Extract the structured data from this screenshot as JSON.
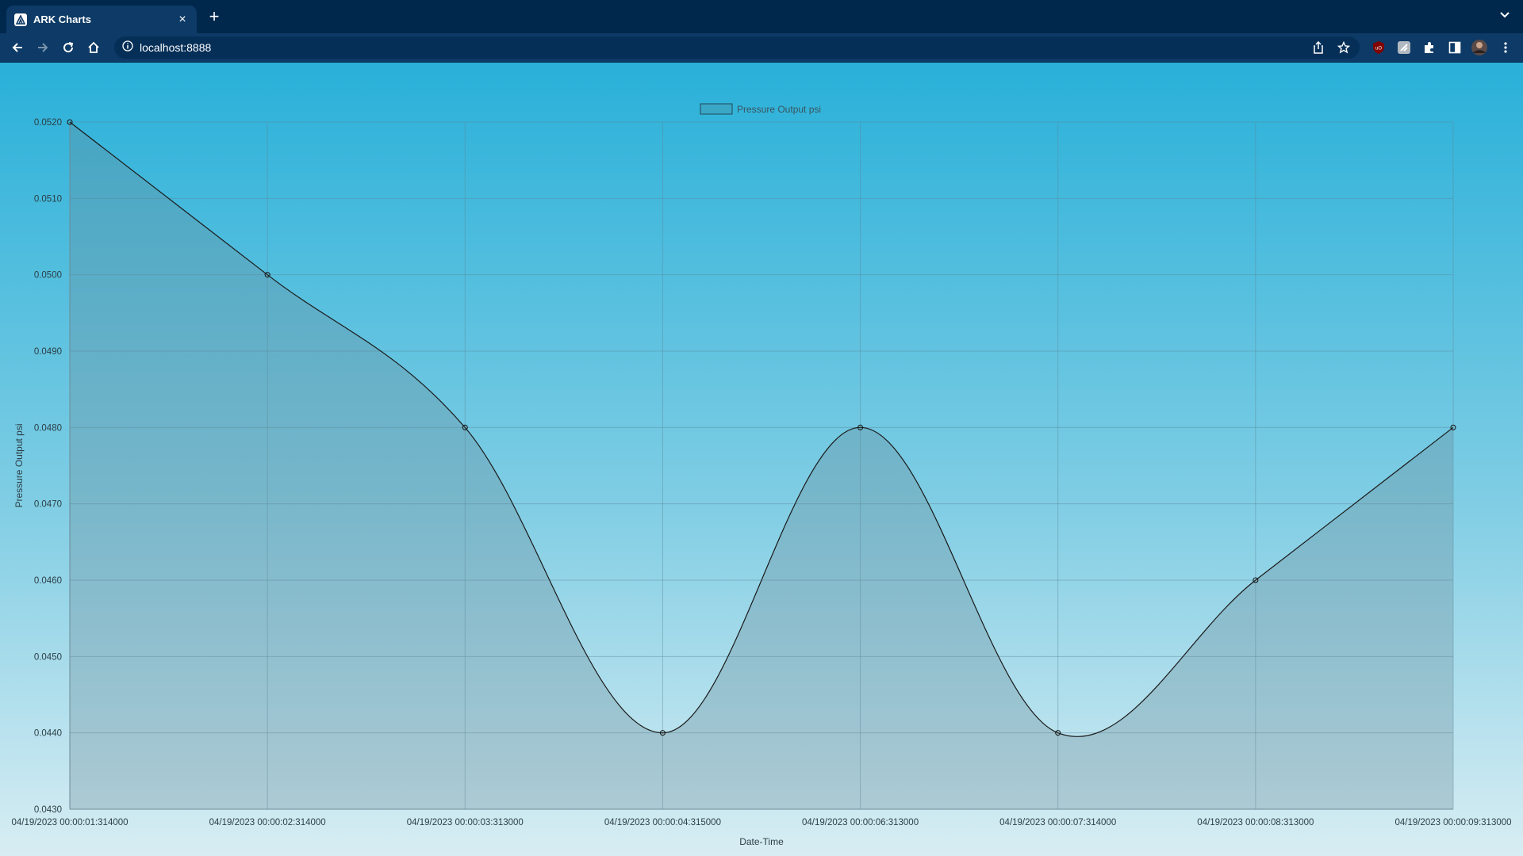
{
  "browser": {
    "tab": {
      "title": "ARK Charts",
      "close": "×"
    },
    "new_tab": "+",
    "tab_menu": "⌄",
    "address": "localhost:8888"
  },
  "chart_data": {
    "type": "line",
    "x": [
      "04/19/2023 00:00:01:314000",
      "04/19/2023 00:00:02:314000",
      "04/19/2023 00:00:03:313000",
      "04/19/2023 00:00:04:315000",
      "04/19/2023 00:00:06:313000",
      "04/19/2023 00:00:07:314000",
      "04/19/2023 00:00:08:313000",
      "04/19/2023 00:00:09:313000"
    ],
    "series": [
      {
        "name": "Pressure Output psi",
        "values": [
          0.052,
          0.05,
          0.048,
          0.044,
          0.048,
          0.044,
          0.046,
          0.048
        ]
      }
    ],
    "xlabel": "Date-Time",
    "ylabel": "Pressure Output psi",
    "ylim": [
      0.043,
      0.052
    ],
    "yticks": [
      "0.0520",
      "0.0510",
      "0.0500",
      "0.0490",
      "0.0480",
      "0.0470",
      "0.0460",
      "0.0450",
      "0.0440",
      "0.0430"
    ],
    "legend": "top-center",
    "grid": true,
    "fill": true,
    "colors": {
      "line": "#1a1a1a",
      "fill": "#6a8a96",
      "grid": "#5a8898"
    }
  }
}
